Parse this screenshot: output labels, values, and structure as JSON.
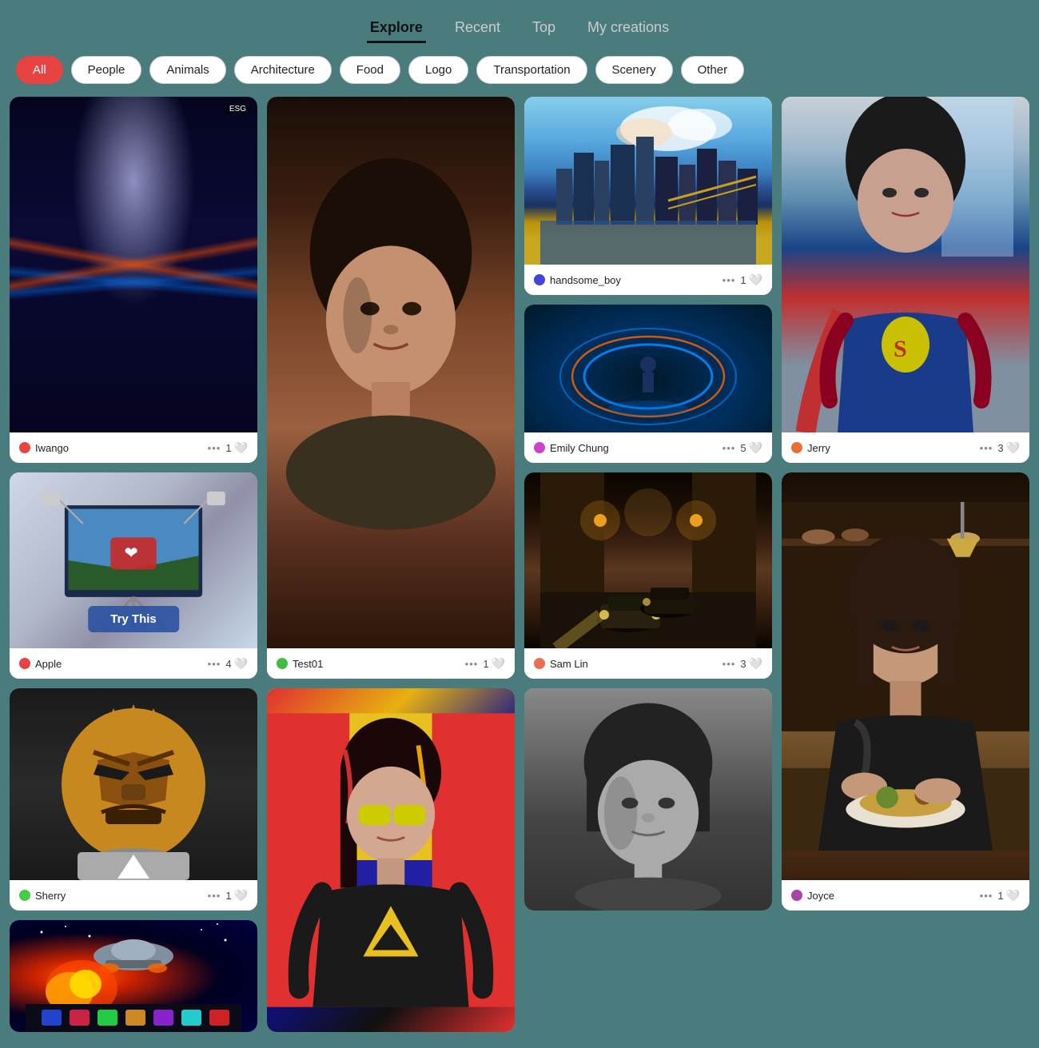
{
  "nav": {
    "tabs": [
      {
        "id": "explore",
        "label": "Explore",
        "active": true
      },
      {
        "id": "recent",
        "label": "Recent",
        "active": false
      },
      {
        "id": "top",
        "label": "Top",
        "active": false
      },
      {
        "id": "my-creations",
        "label": "My creations",
        "active": false
      }
    ]
  },
  "filters": {
    "pills": [
      {
        "id": "all",
        "label": "All",
        "active": true
      },
      {
        "id": "people",
        "label": "People",
        "active": false
      },
      {
        "id": "animals",
        "label": "Animals",
        "active": false
      },
      {
        "id": "architecture",
        "label": "Architecture",
        "active": false
      },
      {
        "id": "food",
        "label": "Food",
        "active": false
      },
      {
        "id": "logo",
        "label": "Logo",
        "active": false
      },
      {
        "id": "transportation",
        "label": "Transportation",
        "active": false
      },
      {
        "id": "scenery",
        "label": "Scenery",
        "active": false
      },
      {
        "id": "other",
        "label": "Other",
        "active": false
      }
    ]
  },
  "cards": [
    {
      "id": "card-1",
      "user": "Iwango",
      "avatar_color": "#e84242",
      "dots": "•••",
      "likes": "1",
      "image_type": "highway",
      "span_tall": false
    },
    {
      "id": "card-2",
      "user": "Test01",
      "avatar_color": "#44bb44",
      "dots": "•••",
      "likes": "1",
      "image_type": "woman-portrait",
      "span_tall": true
    },
    {
      "id": "card-3",
      "user": "handsome_boy",
      "avatar_color": "#4444dd",
      "dots": "•••",
      "likes": "1",
      "image_type": "cityscape",
      "span_tall": false
    },
    {
      "id": "card-4",
      "user": "Jerry",
      "avatar_color": "#e87030",
      "dots": "•••",
      "likes": "3",
      "image_type": "supergirl",
      "span_tall": true
    },
    {
      "id": "card-5",
      "user": "Emily Chung",
      "avatar_color": "#cc44cc",
      "dots": "•••",
      "likes": "5",
      "image_type": "rings",
      "span_tall": false
    },
    {
      "id": "card-6",
      "user": "Apple",
      "avatar_color": "#e84242",
      "dots": "•••",
      "likes": "4",
      "image_type": "studio",
      "try_this": "Try This",
      "span_tall": false
    },
    {
      "id": "card-7",
      "user": "Sam Lin",
      "avatar_color": "#e87050",
      "dots": "•••",
      "likes": "3",
      "image_type": "alley",
      "span_tall": false
    },
    {
      "id": "card-8",
      "user": "Joyce",
      "avatar_color": "#aa44aa",
      "dots": "•••",
      "likes": "1",
      "image_type": "woman-food",
      "span_tall": true
    },
    {
      "id": "card-9",
      "user": "Sherry",
      "avatar_color": "#44cc44",
      "dots": "•••",
      "likes": "1",
      "image_type": "robot",
      "span_tall": false
    },
    {
      "id": "card-10",
      "user": "",
      "avatar_color": "#ccaa00",
      "dots": "",
      "likes": "",
      "image_type": "superhero-woman",
      "span_tall": false,
      "no_footer": true
    },
    {
      "id": "card-11",
      "user": "",
      "avatar_color": "#888",
      "dots": "",
      "likes": "",
      "image_type": "woman-bw",
      "span_tall": false,
      "no_footer": true
    },
    {
      "id": "card-12",
      "user": "",
      "avatar_color": "#888",
      "dots": "",
      "likes": "",
      "image_type": "space",
      "span_tall": false,
      "no_footer": true
    }
  ]
}
